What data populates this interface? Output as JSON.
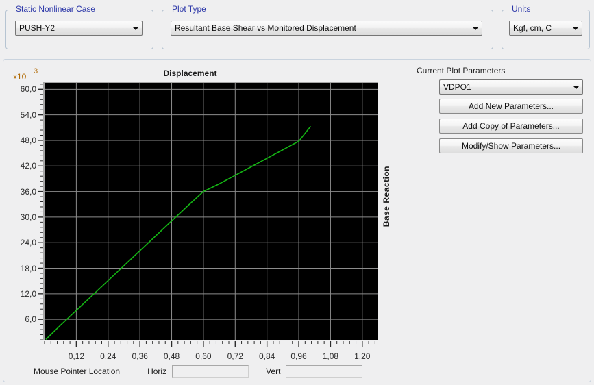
{
  "groups": {
    "static_case": {
      "title": "Static Nonlinear Case",
      "combo_value": "PUSH-Y2",
      "arrow_icon": "chevron-down-icon"
    },
    "plot_type": {
      "title": "Plot Type",
      "combo_value": "Resultant Base Shear vs Monitored Displacement",
      "arrow_icon": "chevron-down-icon"
    },
    "units": {
      "title": "Units",
      "combo_value": "Kgf, cm, C",
      "arrow_icon": "chevron-down-icon"
    }
  },
  "params": {
    "heading": "Current Plot Parameters",
    "combo_value": "VDPO1",
    "arrow_icon": "chevron-down-icon",
    "buttons": [
      "Add New Parameters...",
      "Add Copy of Parameters...",
      "Modify/Show Parameters..."
    ]
  },
  "status": {
    "mouse_label": "Mouse Pointer Location",
    "horiz_label": "Horiz",
    "horiz_value": "",
    "vert_label": "Vert",
    "vert_value": ""
  },
  "colors": {
    "accent_title": "#2b36a8",
    "plot_background": "#000000",
    "grid": "#8c8c8c",
    "series": "#14b414",
    "exponent": "#b06800"
  },
  "chart_data": {
    "type": "line",
    "title": "Displacement",
    "xlabel": "Displacement",
    "ylabel": "Base Reaction",
    "y_exponent_prefix": "x10",
    "y_exponent": "3",
    "grid": true,
    "legend": "none",
    "xlim": [
      0.0,
      1.26
    ],
    "ylim": [
      1.2,
      61.5
    ],
    "xticks": [
      "0,12",
      "0,24",
      "0,36",
      "0,48",
      "0,60",
      "0,72",
      "0,84",
      "0,96",
      "1,08",
      "1,20"
    ],
    "xtick_values": [
      0.12,
      0.24,
      0.36,
      0.48,
      0.6,
      0.72,
      0.84,
      0.96,
      1.08,
      1.2
    ],
    "yticks": [
      "6,0",
      "12,0",
      "18,0",
      "24,0",
      "30,0",
      "36,0",
      "42,0",
      "48,0",
      "54,0",
      "60,0"
    ],
    "ytick_values": [
      6.0,
      12.0,
      18.0,
      24.0,
      30.0,
      36.0,
      42.0,
      48.0,
      54.0,
      60.0
    ],
    "x_minor_per_major": 4,
    "y_minor_per_major": 4,
    "series": [
      {
        "name": "Resultant Base Shear vs Monitored Displacement",
        "color": "#14b414",
        "x": [
          0.005,
          0.06,
          0.12,
          0.18,
          0.24,
          0.3,
          0.36,
          0.42,
          0.48,
          0.54,
          0.6,
          0.63,
          0.66,
          0.72,
          0.78,
          0.84,
          0.9,
          0.96,
          1.005
        ],
        "y": [
          1.3,
          4.6,
          8.1,
          11.6,
          15.1,
          18.6,
          22.1,
          25.6,
          29.1,
          32.6,
          36.0,
          36.9,
          37.8,
          39.8,
          41.8,
          43.8,
          45.8,
          47.8,
          51.3
        ]
      }
    ]
  }
}
